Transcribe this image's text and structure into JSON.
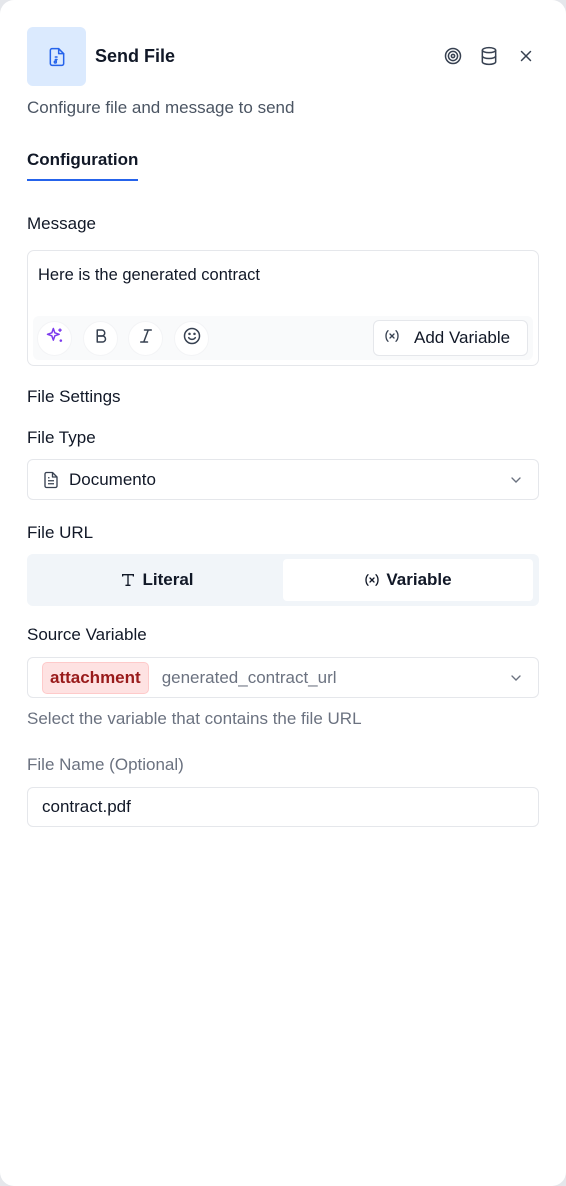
{
  "header": {
    "title": "Send File",
    "subtitle": "Configure file and message to send",
    "icons": [
      "file-icon",
      "target-icon",
      "database-icon",
      "close-icon"
    ]
  },
  "tabs": [
    {
      "label": "Configuration",
      "active": true
    }
  ],
  "message": {
    "label": "Message",
    "value": "Here is the generated contract",
    "toolbar": {
      "ai_icon": "sparkles-icon",
      "bold_icon": "bold-icon",
      "italic_icon": "italic-icon",
      "emoji_icon": "smiley-icon",
      "add_variable_label": "Add Variable"
    }
  },
  "file_settings": {
    "section_label": "File Settings",
    "file_type": {
      "label": "File Type",
      "value": "Documento"
    },
    "file_url": {
      "label": "File URL",
      "options": [
        {
          "label": "Literal",
          "selected": false
        },
        {
          "label": "Variable",
          "selected": true
        }
      ]
    },
    "source_variable": {
      "label": "Source Variable",
      "badge": "attachment",
      "value": "generated_contract_url",
      "help": "Select the variable that contains the file URL"
    },
    "file_name": {
      "label": "File Name (Optional)",
      "value": "contract.pdf"
    }
  },
  "colors": {
    "accent": "#2563eb",
    "icon_bg": "#dbeafe",
    "badge_bg": "#fee2e2",
    "badge_text": "#991b1b",
    "ai_icon": "#7c3aed"
  }
}
